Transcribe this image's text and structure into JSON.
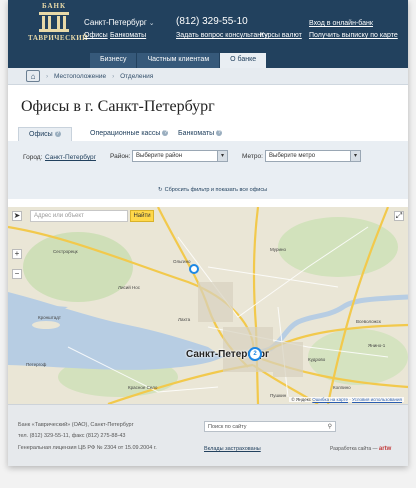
{
  "header": {
    "logo_top": "БАНК",
    "logo_name": "ТАВРИЧЕСКИЙ",
    "city": "Санкт-Петербург",
    "phone": "(812) 329-55-10",
    "links_left": [
      "Офисы",
      "Банкоматы"
    ],
    "ask_consultant": "Задать вопрос консультанту",
    "currency_rates": "Курсы валют",
    "online_bank": "Вход в онлайн-банк",
    "card_statement": "Получить выписку по карте",
    "nav": [
      "Бизнесу",
      "Частным клиентам",
      "О банке"
    ],
    "nav_active": 2
  },
  "breadcrumbs": [
    "Местоположение",
    "Отделения"
  ],
  "page_title": "Офисы в г. Санкт-Петербург",
  "tabs": [
    "Офисы",
    "Операционные кассы",
    "Банкоматы"
  ],
  "filters": {
    "city_label": "Город:",
    "city_value": "Санкт-Петербург",
    "district_label": "Район:",
    "district_value": "Выберите район",
    "metro_label": "Метро:",
    "metro_value": "Выберите метро",
    "reset": "Сбросить фильтр и показать все офисы"
  },
  "map": {
    "search_placeholder": "Адрес или объект",
    "find_button": "Найти",
    "city_name": "Санкт-Петербург",
    "cluster_count": "2",
    "labels": [
      "Ольгино",
      "Лахта",
      "Кронштадт",
      "Петергоф",
      "Лисий Нос",
      "Сестрорецк",
      "Красное Село",
      "Пушкин",
      "Всеволожск",
      "Кудрово",
      "Колпино",
      "Янино-1",
      "Мурино"
    ],
    "copyright_yandex": "© Яндекс",
    "copyright_error": "Ошибка на карте",
    "copyright_terms": "Условия использования"
  },
  "footer": {
    "line1": "Банк «Таврический» (ОАО), Санкт-Петербург",
    "line2": "тел. (812) 329-55-11, факс (812) 275-88-43",
    "line3": "Генеральная лицензия ЦБ РФ № 2304 от 15.09.2004 г.",
    "search_placeholder": "Поиск по сайту",
    "deposits_link": "Вклады застрахованы",
    "dev_label": "Разработка сайта —",
    "dev_name": "artw"
  }
}
